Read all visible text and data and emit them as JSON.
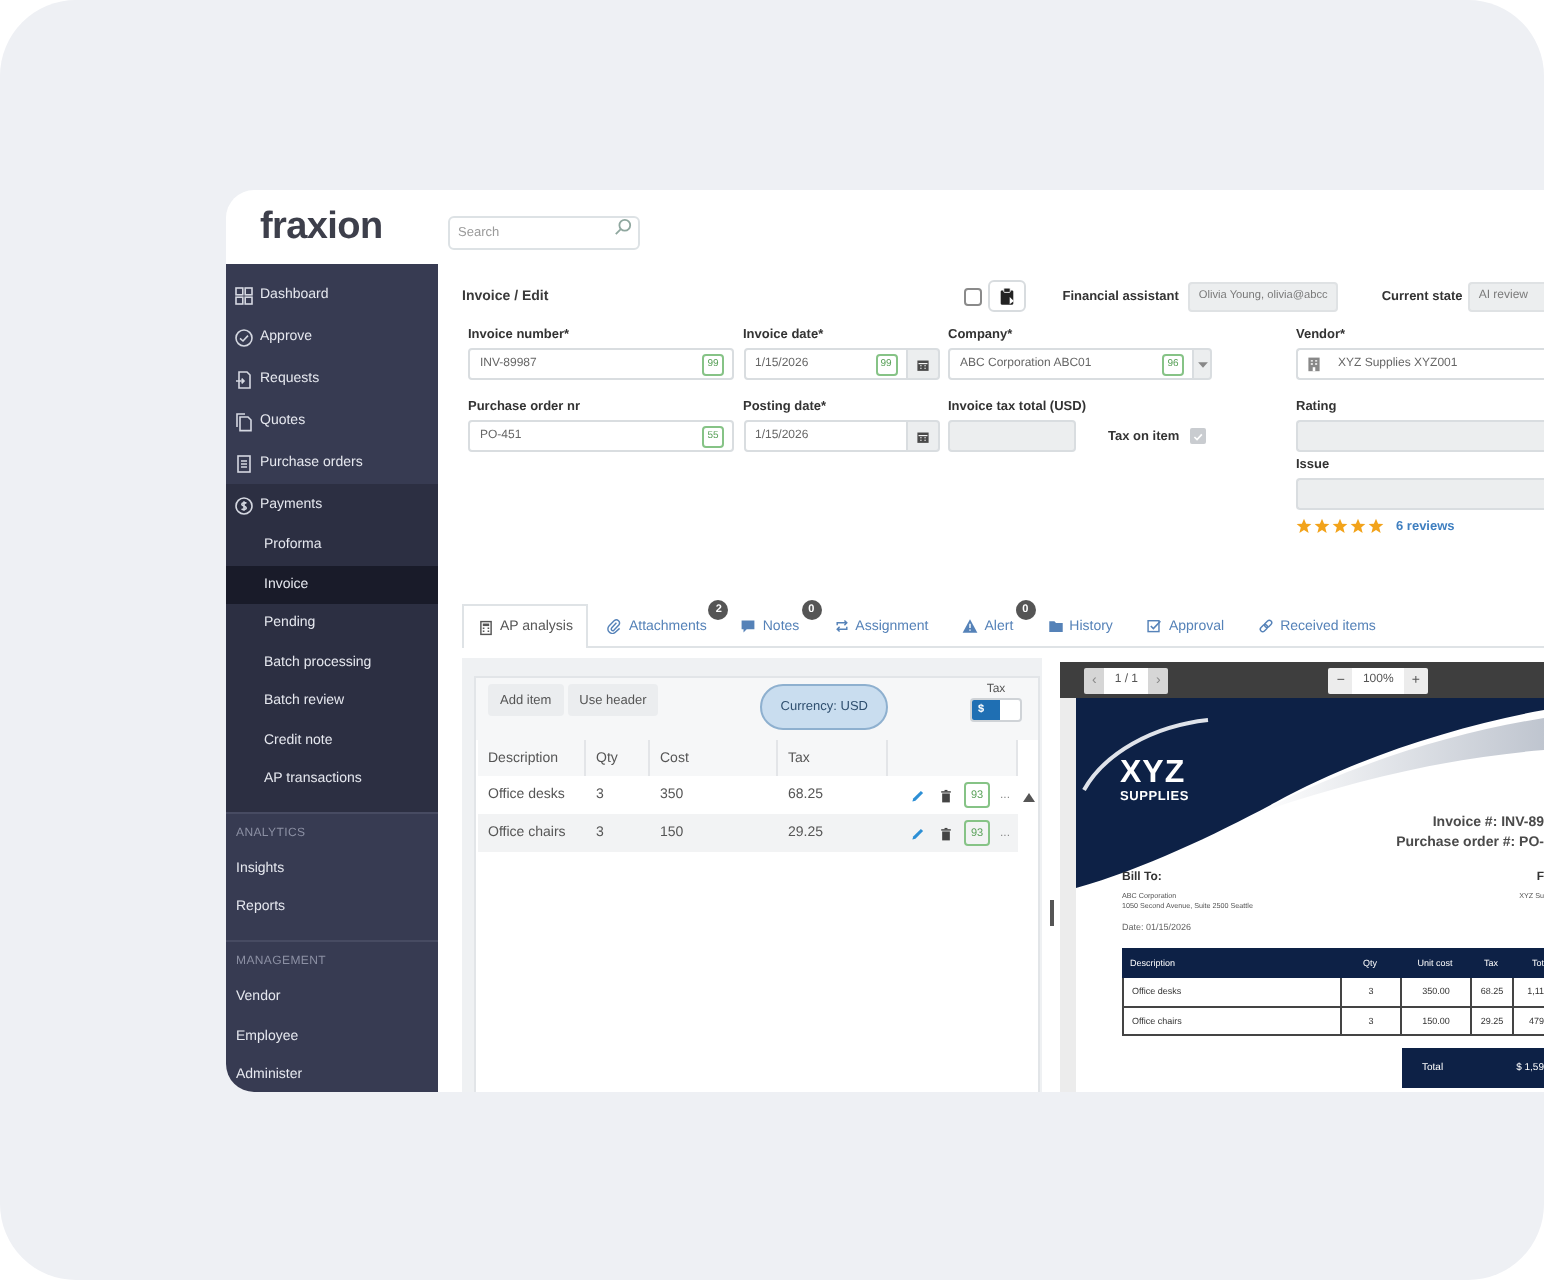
{
  "logo": {
    "text": "fraxion"
  },
  "search": {
    "placeholder": "Search"
  },
  "sidebar": {
    "items": [
      {
        "label": "Dashboard",
        "selected": false
      },
      {
        "label": "Approve",
        "selected": false
      },
      {
        "label": "Requests",
        "selected": false
      },
      {
        "label": "Quotes",
        "selected": false
      },
      {
        "label": "Purchase orders",
        "selected": false
      },
      {
        "label": "Payments",
        "selected": false,
        "expanded": true,
        "children": [
          {
            "label": "Proforma",
            "selected": false
          },
          {
            "label": "Invoice",
            "selected": true
          },
          {
            "label": "Pending",
            "selected": false
          },
          {
            "label": "Batch processing",
            "selected": false
          },
          {
            "label": "Batch review",
            "selected": false
          },
          {
            "label": "Credit note",
            "selected": false
          },
          {
            "label": "AP transactions",
            "selected": false
          }
        ]
      }
    ],
    "sections": [
      {
        "heading": "ANALYTICS",
        "items": [
          {
            "label": "Insights",
            "selected": false
          },
          {
            "label": "Reports",
            "selected": false
          }
        ]
      },
      {
        "heading": "MANAGEMENT",
        "items": [
          {
            "label": "Vendor",
            "selected": false
          },
          {
            "label": "Employee",
            "selected": false
          },
          {
            "label": "Administer",
            "selected": false
          }
        ]
      }
    ]
  },
  "header": {
    "breadcrumb": "Invoice / Edit",
    "checked": false,
    "assistant": {
      "label": "Financial assistant",
      "value": "Olivia Young, olivia@abcc"
    },
    "state": {
      "label": "Current state",
      "value": "AI review"
    }
  },
  "form": {
    "fields": [
      {
        "label": "Invoice number*",
        "kind": "text",
        "value": "INV-89987",
        "badge": "99"
      },
      {
        "label": "Invoice date*",
        "kind": "date",
        "value": "1/15/2026",
        "badge": "99"
      },
      {
        "label": "Company*",
        "kind": "select",
        "value": "ABC Corporation ABC01",
        "badge": "96"
      },
      {
        "label": "Purchase order nr",
        "kind": "text",
        "value": "PO-451",
        "badge": "55"
      },
      {
        "label": "Posting date*",
        "kind": "date",
        "value": "1/15/2026"
      },
      {
        "label": "Invoice tax total (USD)",
        "kind": "readonly",
        "checkbox": {
          "label": "Tax on item",
          "checked": true,
          "disabled": true
        }
      }
    ]
  },
  "vendor": {
    "label": "Vendor*",
    "value": "XYZ Supplies XYZ001",
    "rating": {
      "label": "Rating"
    },
    "issue": {
      "label": "Issue"
    },
    "stars": 5,
    "reviews": "6 reviews"
  },
  "tabs": [
    {
      "label": "AP analysis",
      "selected": true
    },
    {
      "label": "Attachments",
      "badge": "2",
      "selected": false
    },
    {
      "label": "Notes",
      "badge": "0",
      "selected": false
    },
    {
      "label": "Assignment",
      "selected": false
    },
    {
      "label": "Alert",
      "badge": "0",
      "selected": false
    },
    {
      "label": "History",
      "selected": false
    },
    {
      "label": "Approval",
      "selected": false
    },
    {
      "label": "Received items",
      "selected": false
    }
  ],
  "lines": {
    "buttons": [
      "Add item",
      "Use header"
    ],
    "currency": "Currency: USD",
    "tax_toggle": {
      "label": "Tax",
      "symbol": "$",
      "on": true
    },
    "columns": [
      "Description",
      "Qty",
      "Cost",
      "Tax"
    ],
    "rows": [
      {
        "cells": [
          "Office desks",
          "3",
          "350",
          "68.25"
        ],
        "badge": "93",
        "more": "..."
      },
      {
        "cells": [
          "Office chairs",
          "3",
          "150",
          "29.25"
        ],
        "badge": "93",
        "more": "..."
      }
    ]
  },
  "viewer": {
    "prev": "‹",
    "page": "1 / 1",
    "next": "›",
    "zoom_out": "−",
    "zoom": "100%",
    "zoom_in": "+"
  },
  "document": {
    "brand": "XYZ",
    "brand_sub": "SUPPLIES",
    "numbers": [
      "Invoice #: INV-89",
      "Purchase order #: PO-"
    ],
    "bill_to": {
      "heading": "Bill To:",
      "lines": [
        "ABC Corporation",
        "1050 Second Avenue, Suite 2500 Seattle"
      ],
      "date": "Date: 01/15/2026"
    },
    "from": {
      "heading": "F",
      "lines": [
        "XYZ Su"
      ]
    },
    "columns": [
      "Description",
      "Qty",
      "Unit cost",
      "Tax",
      "Tot"
    ],
    "rows": [
      [
        "Office desks",
        "3",
        "350.00",
        "68.25",
        "1,11"
      ],
      [
        "Office chairs",
        "3",
        "150.00",
        "29.25",
        "479"
      ]
    ],
    "total": {
      "label": "Total",
      "value": "$ 1,59"
    }
  }
}
